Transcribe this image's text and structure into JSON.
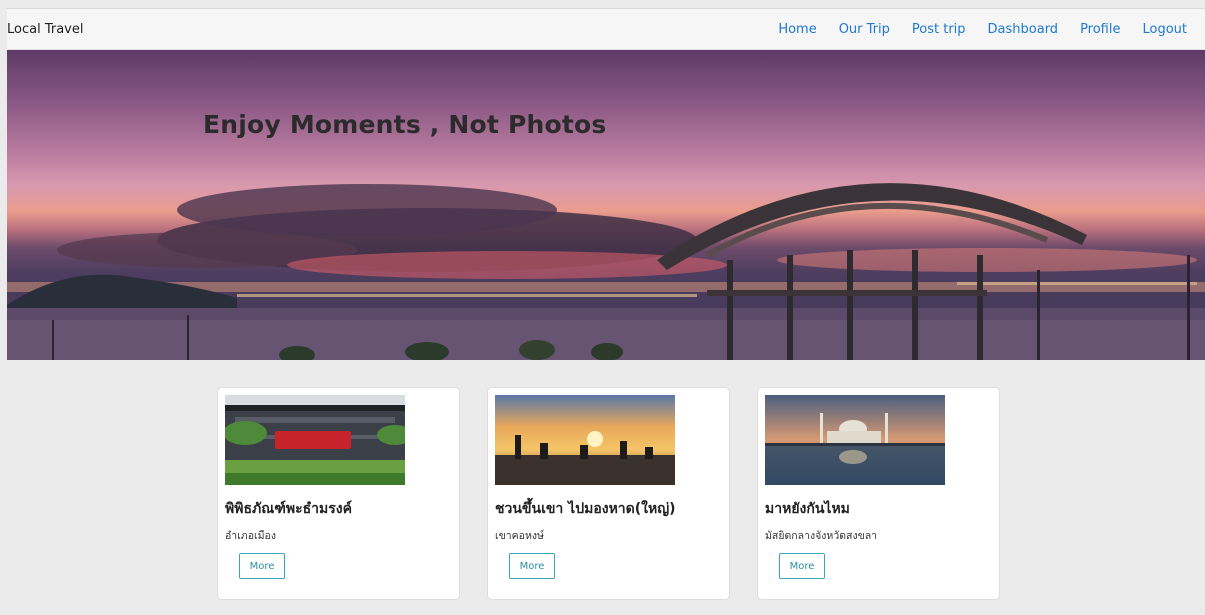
{
  "navbar": {
    "brand": "Local Travel",
    "links": [
      "Home",
      "Our Trip",
      "Post trip",
      "Dashboard",
      "Profile",
      "Logout"
    ]
  },
  "hero": {
    "title": "Enjoy Moments , Not Photos"
  },
  "cards": [
    {
      "title": "พิพิธภัณฑ์พะธำมรงค์",
      "subtitle": "อำเภอเมือง",
      "button": "More"
    },
    {
      "title": "ชวนขึ้นเขา ไปมองหาด(ใหญ่)",
      "subtitle": "เขาคอหงษ์",
      "button": "More"
    },
    {
      "title": "มาหยังกันไหม",
      "subtitle": "มัสยิดกลางจังหวัดสงขลา",
      "button": "More"
    }
  ]
}
